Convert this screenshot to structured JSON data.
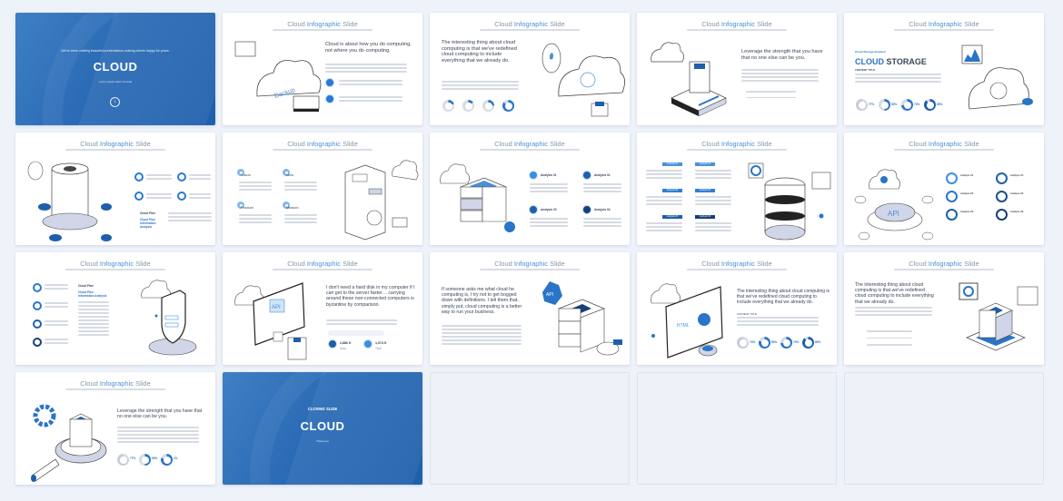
{
  "page": {
    "background": "#eef2f9",
    "accent": "#2a74c9",
    "cover_blue": "#2b6bb5"
  },
  "slides": [
    {
      "type": "cover",
      "tagline": "We've been crafting beautiful presentations making clients happy for years.",
      "title": "CLOUD",
      "small": "Lorem ipsum dolor sit amet",
      "icon": "arrow-down-circle-icon"
    },
    {
      "type": "content",
      "title_a": "Cloud ",
      "title_hl": "Infographic",
      "title_b": " Slide",
      "headline": "Cloud is about how you do computing, not where you do computing.",
      "illustration": "cloud-backup-illustration",
      "badge": "Backup"
    },
    {
      "type": "content",
      "title_a": "Cloud ",
      "title_hl": "Infographic",
      "title_b": " Slide",
      "headline": "The interesting thing about cloud computing is that we've redefined cloud computing to include everything that we already do.",
      "illustration": "cloud-server-illustration"
    },
    {
      "type": "content",
      "title_a": "Cloud ",
      "title_hl": "Infographic",
      "title_b": " Slide",
      "headline": "Leverage the strength that you have that no one else can be you.",
      "illustration": "cloud-chip-illustration"
    },
    {
      "type": "content",
      "title_a": "Cloud ",
      "title_hl": "Infographic",
      "title_b": " Slide",
      "kicker": "Cloud Storage Analized",
      "big_title_a": "CLOUD",
      "big_title_b": " STORAGE",
      "subhead": "CONTENT TITLE",
      "percents": [
        "77%",
        "50%",
        "74%",
        "89%"
      ],
      "illustration": "cloud-lock-key-illustration"
    },
    {
      "type": "content",
      "title_a": "Cloud ",
      "title_hl": "Infographic",
      "title_b": " Slide",
      "labels": [
        "Cloud Plan",
        "Cloud Plan Information Analysis"
      ],
      "illustration": "cloud-cylinder-illustration"
    },
    {
      "type": "content",
      "title_a": "Cloud ",
      "title_hl": "Infographic",
      "title_b": " Slide",
      "items": [
        "Vision",
        "Idea",
        "Product",
        "Mission"
      ],
      "illustration": "server-tower-illustration"
    },
    {
      "type": "content",
      "title_a": "Cloud ",
      "title_hl": "Infographic",
      "title_b": " Slide",
      "items": [
        "Analysis 01",
        "Analysis 02",
        "Analysis 03",
        "Analysis 04"
      ],
      "illustration": "server-stack-illustration"
    },
    {
      "type": "content",
      "title_a": "Cloud ",
      "title_hl": "Infographic",
      "title_b": " Slide",
      "items": [
        "Analysis 01",
        "Analysis 02",
        "Analysis 03",
        "Analysis 04",
        "Analysis 05",
        "Analysis 06"
      ],
      "illustration": "database-illustration"
    },
    {
      "type": "content",
      "title_a": "Cloud ",
      "title_hl": "Infographic",
      "title_b": " Slide",
      "items": [
        "Analysis 01",
        "Analysis 02",
        "Analysis 03",
        "Analysis 04",
        "Analysis 05",
        "Analysis 06"
      ],
      "illustration": "api-hub-illustration",
      "badge": "API"
    },
    {
      "type": "content",
      "title_a": "Cloud ",
      "title_hl": "Infographic",
      "title_b": " Slide",
      "labels": [
        "Cloud Plan",
        "Cloud Plan Information Analysis"
      ],
      "illustration": "security-shield-illustration"
    },
    {
      "type": "content",
      "title_a": "Cloud ",
      "title_hl": "Infographic",
      "title_b": " Slide",
      "headline": "I don't need a hard disk in my computer if I can get to the server faster… carrying around these non-connected computers is byzantine by comparison.",
      "stats": [
        {
          "value": "2,886 K",
          "label": "Data"
        },
        {
          "value": "1,074 K",
          "label": "Total"
        }
      ],
      "illustration": "api-monitor-illustration",
      "badge": "API"
    },
    {
      "type": "content",
      "title_a": "Cloud ",
      "title_hl": "Infographic",
      "title_b": " Slide",
      "headline": "If someone asks me what cloud he computing is, I try not to get bogged down with definitions. I tell them that, simply put, cloud computing is a better way to run your business.",
      "illustration": "server-usb-illustration",
      "badge": "API"
    },
    {
      "type": "content",
      "title_a": "Cloud ",
      "title_hl": "Infographic",
      "title_b": " Slide",
      "headline": "The interesting thing about cloud computing is that we've redefined cloud computing to include everything that we already do.",
      "subhead": "CONTENT TITLE",
      "percents": [
        "74%",
        "80%",
        "74%",
        "89%"
      ],
      "illustration": "html-browser-illustration",
      "badge": "HTML"
    },
    {
      "type": "content",
      "title_a": "Cloud ",
      "title_hl": "Infographic",
      "title_b": " Slide",
      "headline": "The interesting thing about cloud computing is that we've redefined cloud computing to include everything that we already do.",
      "illustration": "server-platform-illustration"
    },
    {
      "type": "content",
      "title_a": "Cloud ",
      "title_hl": "Infographic",
      "title_b": " Slide",
      "headline": "Leverage the strength that you have that no one else can be you.",
      "percents": [
        "77%",
        "50%",
        "1%"
      ],
      "illustration": "magnifier-server-illustration"
    },
    {
      "type": "closing",
      "tagline": "CLOSING SLIDE",
      "title": "CLOUD",
      "small": "Thank you"
    },
    {
      "type": "empty"
    },
    {
      "type": "empty"
    },
    {
      "type": "empty"
    }
  ]
}
